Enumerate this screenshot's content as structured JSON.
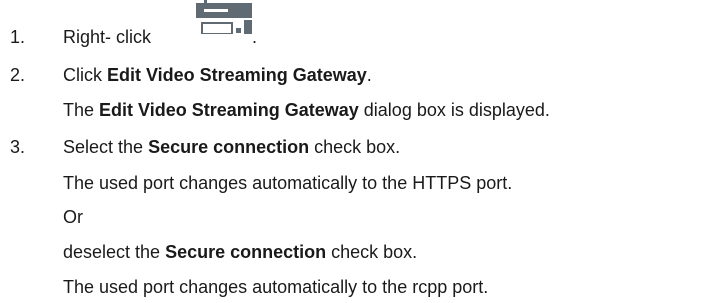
{
  "steps": [
    {
      "number": "1.",
      "text": "Right- click",
      "suffix": "."
    },
    {
      "number": "2.",
      "pre": "Click ",
      "bold": "Edit Video Streaming Gateway",
      "post": ".",
      "result_pre": "The ",
      "result_bold": "Edit Video Streaming Gateway",
      "result_post": " dialog box is displayed."
    },
    {
      "number": "3.",
      "pre": "Select the ",
      "bold": "Secure connection",
      "post": " check box.",
      "line2": "The used port changes automatically to the HTTPS port.",
      "line3": "Or",
      "line4_pre": "deselect the ",
      "line4_bold": "Secure connection",
      "line4_post": " check box.",
      "line5": "The used port changes automatically to the rcpp port."
    }
  ],
  "icons": {
    "step1": "video-streaming-gateway-icon",
    "icon_color": "#5f6a72"
  }
}
